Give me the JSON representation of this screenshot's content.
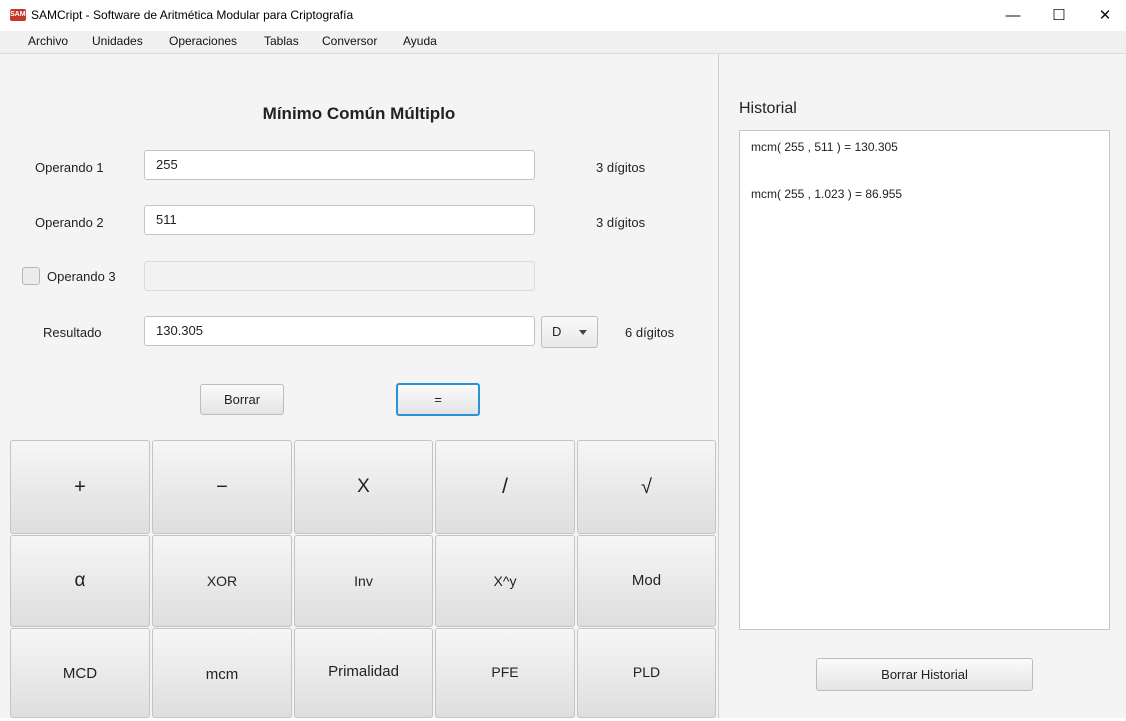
{
  "window": {
    "logo_text": "SAMCript",
    "title": "SAMCript - Software de Aritmética Modular para Criptografía",
    "minimize": "—",
    "maximize": "☐",
    "close": "✕"
  },
  "menu": [
    "Archivo",
    "Unidades",
    "Operaciones",
    "Tablas",
    "Conversor",
    "Ayuda"
  ],
  "form": {
    "heading": "Mínimo Común Múltiplo",
    "op1": {
      "label": "Operando 1",
      "value": "255",
      "digits": "3 dígitos"
    },
    "op2": {
      "label": "Operando 2",
      "value": "511",
      "digits": "3 dígitos"
    },
    "op3": {
      "label": "Operando 3",
      "value": "",
      "checked": false
    },
    "result": {
      "label": "Resultado",
      "value": "130.305",
      "base": "D",
      "digits": "6 dígitos"
    },
    "clear_label": "Borrar",
    "equals_label": "="
  },
  "keypad": [
    [
      "+",
      "−",
      "X",
      "/",
      "√"
    ],
    [
      "α",
      "XOR",
      "Inv",
      "X^y",
      "Mod"
    ],
    [
      "MCD",
      "mcm",
      "Primalidad",
      "PFE",
      "PLD"
    ]
  ],
  "history": {
    "title": "Historial",
    "entries": [
      "mcm( 255 , 511 ) = 130.305",
      "mcm( 255 , 1.023 ) = 86.955"
    ],
    "clear_label": "Borrar Historial"
  }
}
